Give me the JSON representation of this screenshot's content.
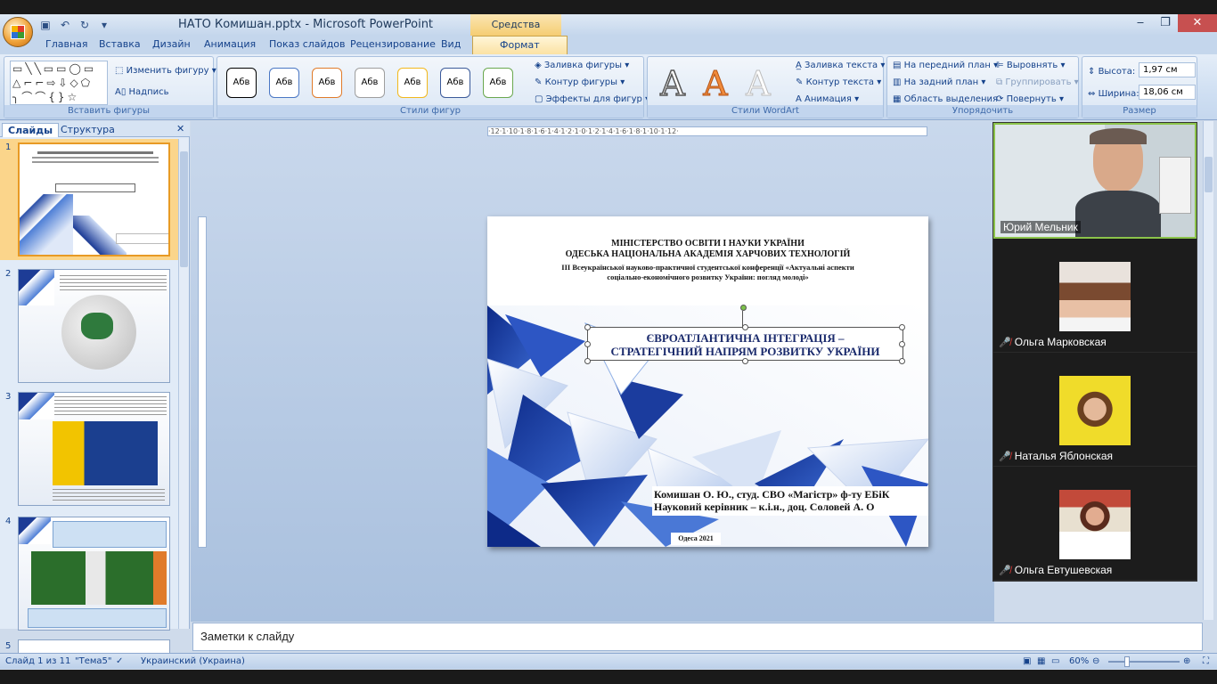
{
  "window": {
    "title": "НАТО Комишан.pptx - Microsoft PowerPoint",
    "context_tool": "Средства рисования"
  },
  "tabs": [
    "Главная",
    "Вставка",
    "Дизайн",
    "Анимация",
    "Показ слайдов",
    "Рецензирование",
    "Вид",
    "Формат"
  ],
  "ribbon": {
    "insert_shapes": {
      "change_shape": "Изменить фигуру",
      "text_box": "Надпись",
      "label": "Вставить фигуры"
    },
    "shape_styles": {
      "sample": "Абв",
      "fill": "Заливка фигуры",
      "outline": "Контур фигуры",
      "effects": "Эффекты для фигур",
      "label": "Стили фигур"
    },
    "wordart": {
      "sample": "A",
      "text_fill": "Заливка текста",
      "text_outline": "Контур текста",
      "animation": "Анимация",
      "label": "Стили WordArt"
    },
    "arrange": {
      "bring_front": "На передний план",
      "send_back": "На задний план",
      "selection_pane": "Область выделения",
      "align": "Выровнять",
      "group": "Группировать",
      "rotate": "Повернуть",
      "label": "Упорядочить"
    },
    "size": {
      "height_label": "Высота:",
      "height_value": "1,97 см",
      "width_label": "Ширина:",
      "width_value": "18,06 см",
      "label": "Размер"
    }
  },
  "panel": {
    "tab_slides": "Слайды",
    "tab_outline": "Структура",
    "slide_numbers": [
      "1",
      "2",
      "3",
      "4",
      "5"
    ]
  },
  "slide": {
    "ministry": "МІНІСТЕРСТВО  ОСВІТИ  І НАУКИ УКРАЇНИ",
    "academy": "ОДЕСЬКА НАЦІОНАЛЬНА АКАДЕМІЯ ХАРЧОВИХ ТЕХНОЛОГІЙ",
    "conference_1": "ІІІ Всеукраїнської науково-практичної студентської конференції «Актуальні аспекти",
    "conference_2": "соціально-економічного розвитку України: погляд молоді»",
    "title_1": "ЄВРОАТЛАНТИЧНА ІНТЕГРАЦІЯ –",
    "title_2": "СТРАТЕГІЧНИЙ НАПРЯМ РОЗВИТКУ УКРАЇНИ",
    "author": "Комишан О. Ю., студ. СВО «Магістр» ф-ту ЕБіК",
    "advisor": "Науковий керівник – к.і.н., доц. Соловей А. О",
    "city": "Одеса 2021"
  },
  "ruler_labels": "·12·1·10·1·8·1·6·1·4·1·2·1·0·1·2·1·4·1·6·1·8·1·10·1·12·",
  "video": {
    "participants": [
      {
        "name": "Юрий Мельник",
        "muted": false
      },
      {
        "name": "Ольга Марковская",
        "muted": true
      },
      {
        "name": "Наталья Яблонская",
        "muted": true
      },
      {
        "name": "Ольга Евтушевская",
        "muted": true
      }
    ]
  },
  "notes_placeholder": "Заметки к слайду",
  "status": {
    "slide_info": "Слайд 1 из 11",
    "theme": "\"Тема5\"",
    "language": "Украинский (Украина)",
    "zoom": "60%"
  },
  "colors": {
    "accent": "#fbd58b",
    "ribbon": "#dbe7f5",
    "slide_blue": "#1a2a6c"
  }
}
